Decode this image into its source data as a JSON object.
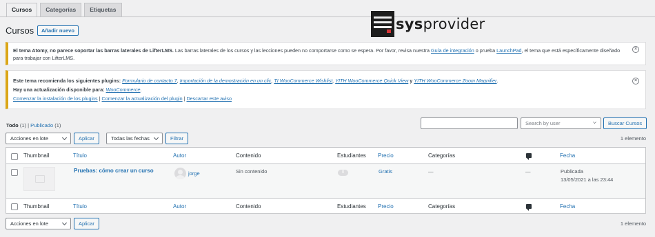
{
  "tabs": [
    {
      "label": "Cursos",
      "active": true
    },
    {
      "label": "Categorías",
      "active": false
    },
    {
      "label": "Etiquetas",
      "active": false
    }
  ],
  "page_title": "Cursos",
  "add_new_label": "Añadir nuevo",
  "logo": {
    "bold": "sys",
    "rest": "provider"
  },
  "notice1": {
    "part1_bold": "El tema Atomy, no parece soportar las barras laterales de LifterLMS.",
    "part2": " Las barras laterales de los cursos y las lecciones pueden no comportarse como se espera. Por favor, revisa nuestra ",
    "link1": "Guía de integración",
    "part3": " o prueba ",
    "link2": "LaunchPad",
    "part4": ", el tema que está específicamente diseñado para trabajar con LifterLMS."
  },
  "notice2": {
    "intro": "Este tema recomienda los siguientes plugins: ",
    "plugins": [
      "Formulario de contacto 7",
      "Importación de la demostración en un clic",
      "TI WooCommerce Wishlist",
      "YITH WooCommerce Quick View"
    ],
    "and": " y ",
    "last_plugin": "YITH WooCommerce Zoom Magnifier",
    "update_intro": "Hay una actualización disponible para: ",
    "update_plugin": "WooCommerce",
    "actions": [
      "Comenzar la instalación de los plugins",
      "Comenzar la actualización del plugin",
      "Descartar este aviso"
    ]
  },
  "views": {
    "all": "Todo",
    "all_count": "(1)",
    "sep": " | ",
    "published": "Publicado",
    "published_count": "(1)"
  },
  "search": {
    "button": "Buscar Cursos",
    "user_placeholder": "Search by user"
  },
  "bulk": {
    "select": "Acciones en lote",
    "apply": "Aplicar"
  },
  "dates": {
    "select": "Todas las fechas",
    "filter": "Filtrar"
  },
  "items_count": "1 elemento",
  "columns": {
    "thumbnail": "Thumbnail",
    "title": "Título",
    "author": "Autor",
    "content": "Contenido",
    "students": "Estudiantes",
    "price": "Precio",
    "categories": "Categorías",
    "date": "Fecha"
  },
  "row": {
    "title": "Pruebas: cómo crear un curso",
    "author": "jorge",
    "content": "Sin contenido",
    "students": "0",
    "price": "Gratis",
    "categories": "—",
    "comments": "—",
    "status": "Publicada",
    "date": "13/05/2021 a las 23:44"
  }
}
